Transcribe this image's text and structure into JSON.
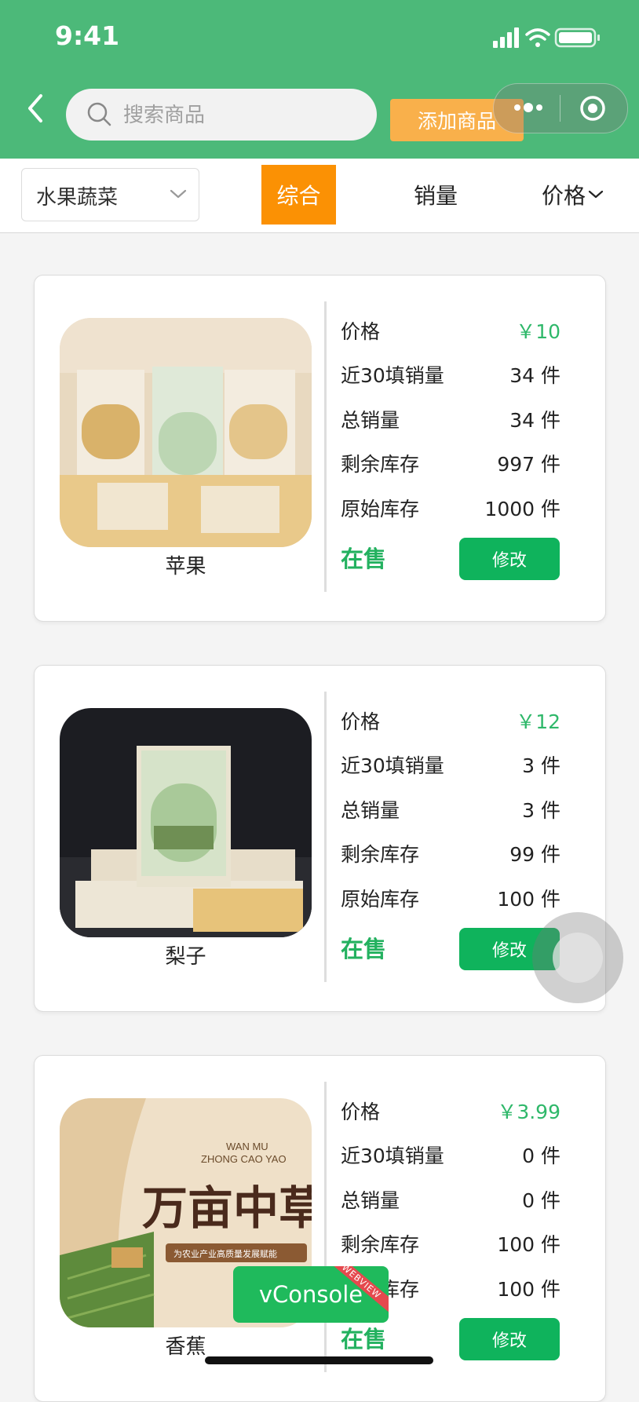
{
  "status_bar": {
    "time": "9:41"
  },
  "header": {
    "search_placeholder": "搜索商品",
    "add_button_label": "添加商品"
  },
  "filter_bar": {
    "category": "水果蔬菜",
    "sort_options": [
      "综合",
      "销量",
      "价格"
    ],
    "active_sort": "综合"
  },
  "products": [
    {
      "name": "苹果",
      "labels": {
        "price": "价格",
        "sales30": "近30填销量",
        "total_sales": "总销量",
        "stock_left": "剩余库存",
        "stock_orig": "原始库存"
      },
      "price": "￥10",
      "sales30": "34 件",
      "total_sales": "34 件",
      "stock_left": "997 件",
      "stock_orig": "1000 件",
      "status": "在售",
      "edit_label": "修改"
    },
    {
      "name": "梨子",
      "labels": {
        "price": "价格",
        "sales30": "近30填销量",
        "total_sales": "总销量",
        "stock_left": "剩余库存",
        "stock_orig": "原始库存"
      },
      "price": "￥12",
      "sales30": "3 件",
      "total_sales": "3 件",
      "stock_left": "99 件",
      "stock_orig": "100 件",
      "status": "在售",
      "edit_label": "修改"
    },
    {
      "name": "香蕉",
      "labels": {
        "price": "价格",
        "sales30": "近30填销量",
        "total_sales": "总销量",
        "stock_left": "剩余库存",
        "stock_orig": "原始库存"
      },
      "price": "￥3.99",
      "sales30": "0 件",
      "total_sales": "0 件",
      "stock_left": "100 件",
      "stock_orig": "100 件",
      "status": "在售",
      "edit_label": "修改",
      "image_text": {
        "brand_en_1": "WAN MU",
        "brand_en_2": "ZHONG CAO YAO",
        "title": "万亩中草药",
        "slogan": "为农业产业高质量发展赋能"
      }
    }
  ],
  "vconsole": {
    "label": "vConsole",
    "tag": "WEBVIEW"
  },
  "colors": {
    "header": "#4cb979",
    "accent_orange": "#fb9104",
    "add_button": "#f9b04b",
    "price_green": "#2fb86a",
    "button_green": "#0fb35c"
  }
}
